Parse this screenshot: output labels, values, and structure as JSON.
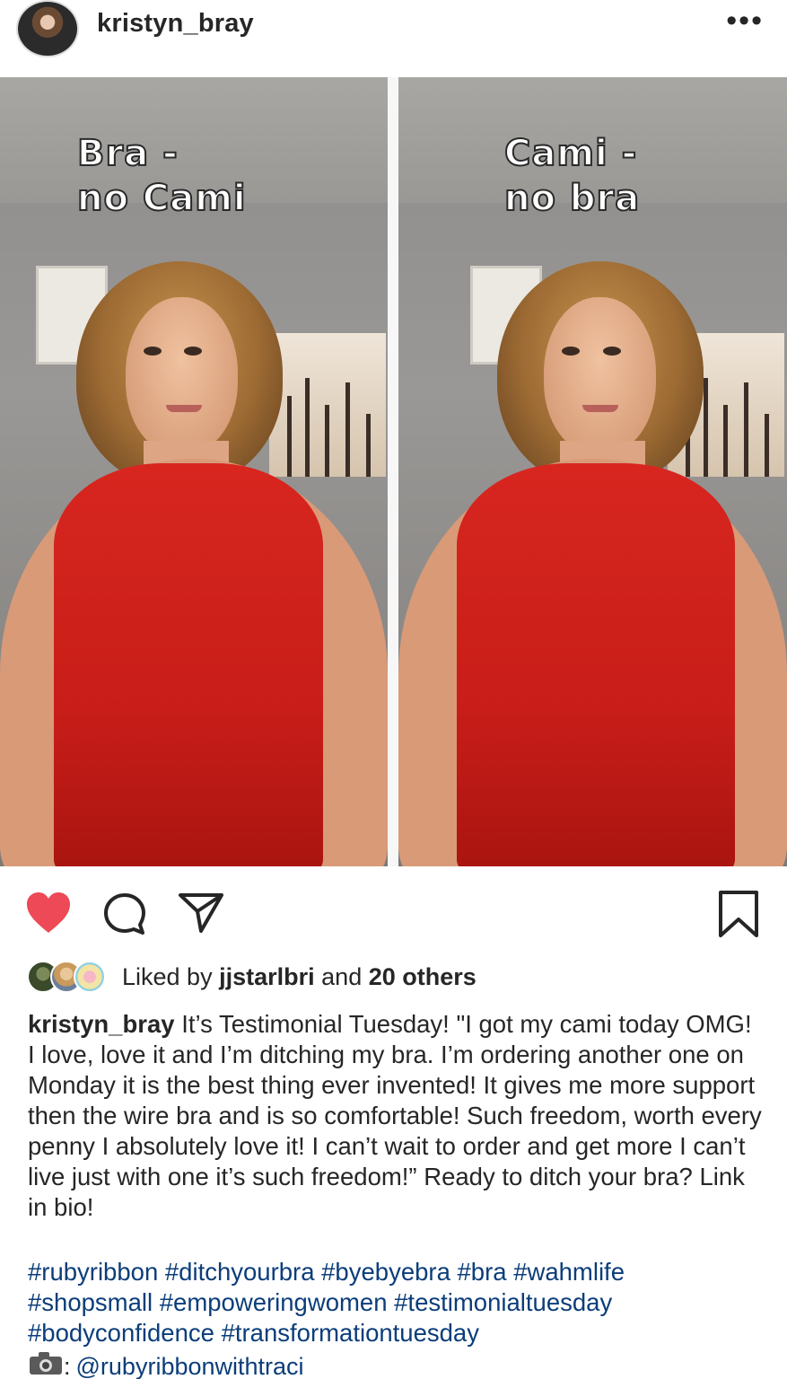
{
  "post": {
    "username": "kristyn_bray",
    "more_label": "•••"
  },
  "photo": {
    "left_caption_line1": "Bra -",
    "left_caption_line2": "no Cami",
    "right_caption_line1": "Cami -",
    "right_caption_line2": "no bra"
  },
  "actions": {
    "like_icon": "heart-filled-icon",
    "comment_icon": "comment-icon",
    "share_icon": "share-icon",
    "save_icon": "bookmark-icon",
    "like_color": "#ed4956"
  },
  "likes": {
    "prefix": "Liked by",
    "user": "jjstarlbri",
    "middle": "and",
    "others": "20 others"
  },
  "caption": {
    "username": "kristyn_bray",
    "text": "It’s Testimonial Tuesday! \"I got my cami today OMG! I love, love it and I’m ditching my bra. I’m ordering another one on Monday it is the best thing ever invented! It gives me more support then the wire bra and is so comfortable! Such freedom, worth every penny I absolutely love it! I can’t wait to order and get more I can’t live just with one it’s such freedom!” Ready to ditch your bra? Link in bio!",
    "hashtags": [
      "#rubyribbon",
      "#ditchyourbra",
      "#byebyebra",
      "#bra",
      "#wahmlife",
      "#shopsmall",
      "#empoweringwomen",
      " #testimonialtuesday",
      "#bodyconfidence",
      "#transformationtuesday"
    ],
    "credit_icon": "camera-icon",
    "credit_sep": ":",
    "credit_handle": "@rubyribbonwithtraci"
  }
}
